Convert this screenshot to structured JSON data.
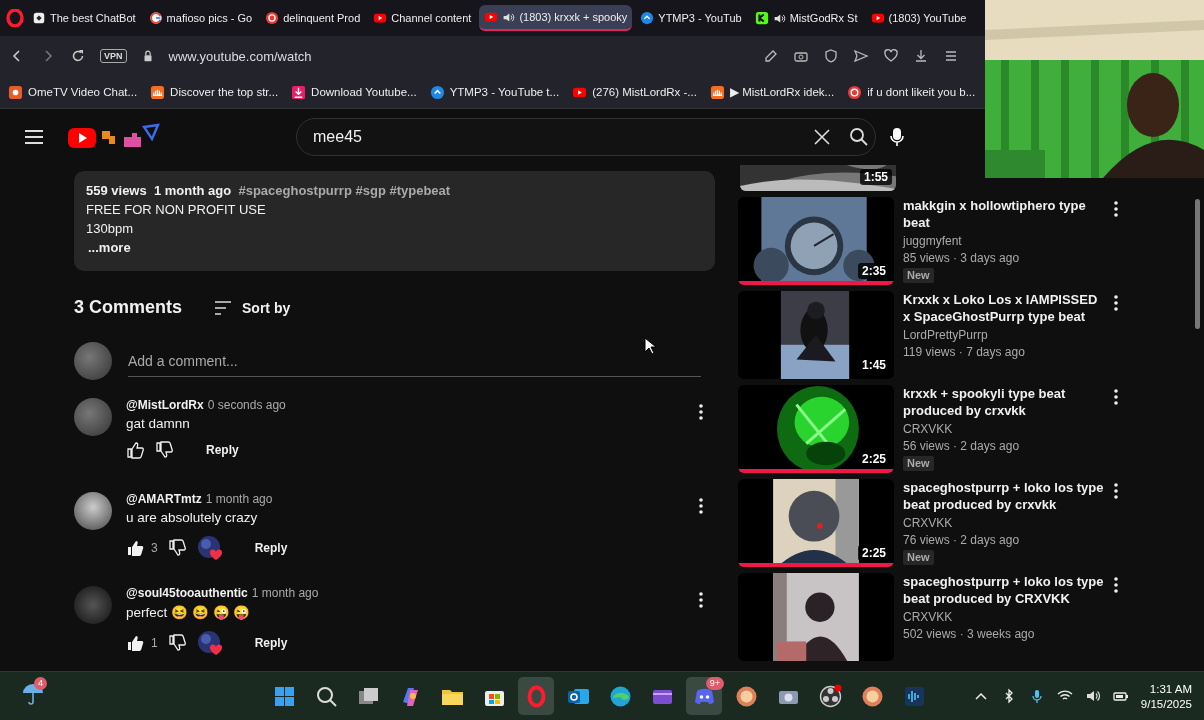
{
  "browser": {
    "tabs": [
      {
        "title": "The best ChatBot",
        "selected": false,
        "audio": false
      },
      {
        "title": "mafioso pics - Go",
        "selected": false,
        "audio": false
      },
      {
        "title": "delinquent Prod",
        "selected": false,
        "audio": false
      },
      {
        "title": "Channel content",
        "selected": false,
        "audio": false
      },
      {
        "title": "(1803) krxxk + spooky",
        "selected": true,
        "audio": true
      },
      {
        "title": "YTMP3 - YouTub",
        "selected": false,
        "audio": false
      },
      {
        "title": "MistGodRx St",
        "selected": false,
        "audio": true
      },
      {
        "title": "(1803) YouTube",
        "selected": false,
        "audio": false
      }
    ],
    "vpn": "VPN",
    "url": "www.youtube.com/watch",
    "bookmarks": [
      "OmeTV Video Chat...",
      "Discover the top str...",
      "Download Youtube...",
      "YTMP3 - YouTube t...",
      "(276) MistLordRx -...",
      "▶ MistLordRx idek...",
      "if u dont likeit you b..."
    ]
  },
  "youtube": {
    "search": {
      "value": "mee45"
    },
    "description": {
      "views": "559 views",
      "age": "1 month ago",
      "tags": "#spaceghostpurrp #sgp #typebeat",
      "lines": [
        "FREE FOR NON PROFIT USE",
        "130bpm"
      ],
      "more": "...more"
    },
    "comments_header": {
      "count": "3 Comments",
      "sort": "Sort by"
    },
    "add_comment": {
      "placeholder": "Add a comment..."
    },
    "comments": [
      {
        "author": "@MistLordRx",
        "time": "0 seconds ago",
        "text": "gat damnn",
        "liked": false,
        "hearted": false,
        "reply": "Reply"
      },
      {
        "author": "@AMARTmtz",
        "time": "1 month ago",
        "text": "u are absolutely crazy",
        "likes": "3",
        "liked": true,
        "hearted": true,
        "reply": "Reply"
      },
      {
        "author": "@soul45tooauthentic",
        "time": "1 month ago",
        "text": "perfect 😆 😆 😜 😜",
        "likes": "1",
        "liked": true,
        "hearted": true,
        "reply": "Reply"
      }
    ],
    "related": [
      {
        "kind": "cut",
        "duration": "1:55"
      },
      {
        "kind": "video",
        "title": "makkgin x hollowtiphero type beat",
        "channel": "juggmyfent",
        "meta": "85 views · 3 days ago",
        "badge": "New",
        "duration": "2:35",
        "level": 1
      },
      {
        "kind": "video",
        "title": "Krxxk x Loko Los x IAMPISSED x SpaceGhostPurrp type beat",
        "channel": "LordPrettyPurrp",
        "meta": "119 views · 7 days ago",
        "duration": "1:45"
      },
      {
        "kind": "video",
        "title": "krxxk + spookyli type beat produced by crxvkk",
        "channel": "CRXVKK",
        "meta": "56 views · 2 days ago",
        "badge": "New",
        "duration": "2:25",
        "level": 1
      },
      {
        "kind": "video",
        "title": "spaceghostpurrp + loko los type beat produced by crxvkk",
        "channel": "CRXVKK",
        "meta": "76 views · 2 days ago",
        "badge": "New",
        "duration": "2:25",
        "level": 1
      },
      {
        "kind": "video",
        "title": "spaceghostpurrp + loko los type beat produced by CRXVKK",
        "channel": "CRXVKK",
        "meta": "502 views · 3 weeks ago"
      }
    ]
  },
  "taskbar": {
    "weather_badge": "4",
    "apps": [
      {
        "kind": "start",
        "active": false
      },
      {
        "kind": "search",
        "active": false
      },
      {
        "kind": "taskview",
        "active": false
      },
      {
        "kind": "copilot",
        "active": false
      },
      {
        "kind": "folder",
        "active": false
      },
      {
        "kind": "store",
        "active": false
      },
      {
        "kind": "opera",
        "active": true
      },
      {
        "kind": "mail",
        "active": false
      },
      {
        "kind": "edge",
        "active": false
      },
      {
        "kind": "clip",
        "active": false
      },
      {
        "kind": "discord",
        "active": true,
        "badge": "9+"
      },
      {
        "kind": "round",
        "active": false
      },
      {
        "kind": "camera",
        "active": false
      },
      {
        "kind": "obs",
        "active": false
      },
      {
        "kind": "round",
        "active": false
      },
      {
        "kind": "audio",
        "active": false
      }
    ],
    "time": "1:31 AM",
    "date": "9/15/2025"
  }
}
